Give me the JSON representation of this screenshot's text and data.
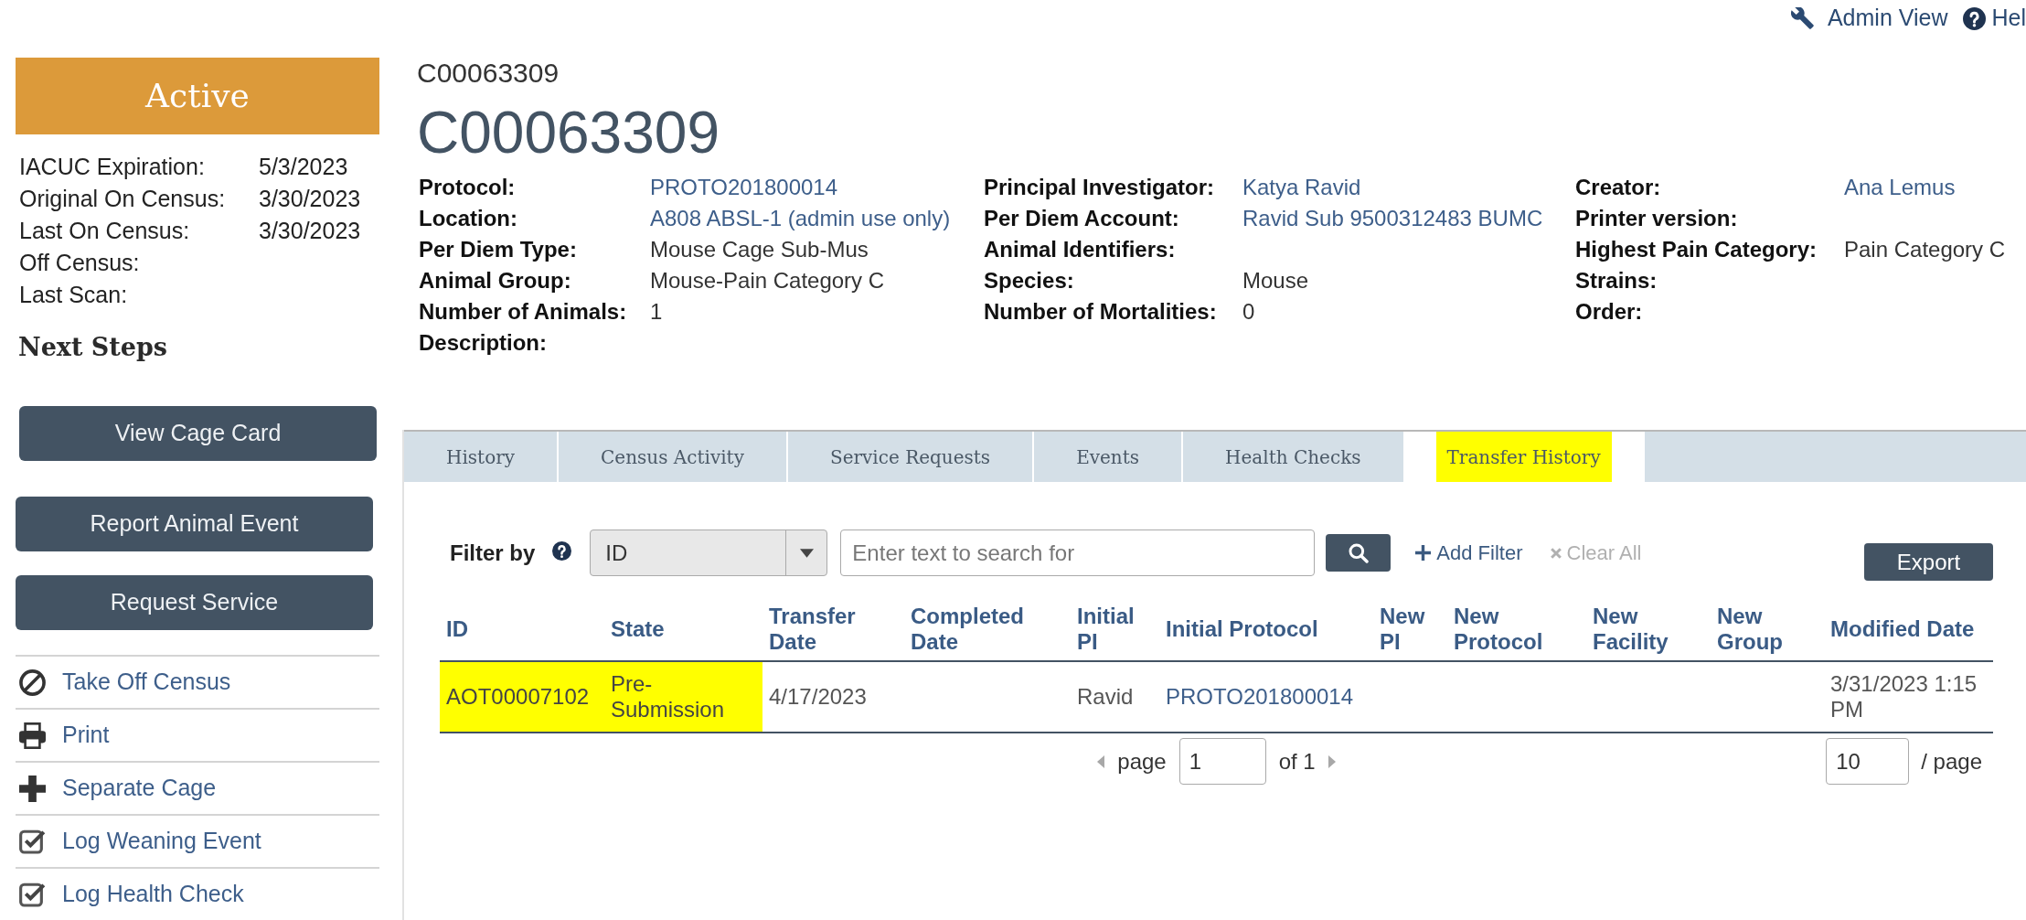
{
  "top_links": [
    {
      "kind": "admin",
      "label": "Admin View"
    },
    {
      "kind": "help",
      "label": "Hel"
    }
  ],
  "sidebar": {
    "status": "Active",
    "details": [
      {
        "label": "IACUC Expiration:",
        "value": "5/3/2023"
      },
      {
        "label": "Original On Census:",
        "value": "3/30/2023"
      },
      {
        "label": "Last On Census:",
        "value": "3/30/2023"
      },
      {
        "label": "Off Census:"
      },
      {
        "label": "Last Scan:"
      }
    ],
    "next_steps_title": "Next Steps",
    "buttons": [
      "View Cage Card",
      "Report Animal Event",
      "Request Service"
    ],
    "actions": [
      {
        "kind": "ban",
        "label": "Take Off Census"
      },
      {
        "kind": "print",
        "label": "Print"
      },
      {
        "kind": "plus",
        "label": "Separate Cage"
      },
      {
        "kind": "check",
        "label": "Log Weaning Event"
      },
      {
        "kind": "check",
        "label": "Log Health Check"
      }
    ]
  },
  "record": {
    "subtitle": "C00063309",
    "title": "C00063309",
    "field_columns": [
      [
        {
          "label": "Protocol:",
          "value": "PROTO201800014",
          "kind": "link"
        },
        {
          "label": "Location:",
          "value": "A808 ABSL-1 (admin use only)",
          "kind": "link"
        },
        {
          "label": "Per Diem Type:",
          "value": "Mouse Cage Sub-Mus",
          "kind": "text"
        },
        {
          "label": "Animal Group:",
          "value": "Mouse-Pain Category C",
          "kind": "text"
        },
        {
          "label": "Number of Animals:",
          "value": "1",
          "kind": "text"
        },
        {
          "label": "Description:"
        }
      ],
      [
        {
          "label": "Principal Investigator:",
          "value": "Katya Ravid",
          "kind": "link"
        },
        {
          "label": "Per Diem Account:",
          "value": "Ravid Sub 9500312483 BUMC",
          "kind": "link"
        },
        {
          "label": "Animal Identifiers:"
        },
        {
          "label": "Species:",
          "value": "Mouse",
          "kind": "text"
        },
        {
          "label": "Number of Mortalities:",
          "value": "0",
          "kind": "text"
        }
      ],
      [
        {
          "label": "Creator:",
          "value": "Ana Lemus",
          "kind": "link"
        },
        {
          "label": "Printer version:"
        },
        {
          "label": "Highest Pain Category:",
          "value": "Pain Category C",
          "kind": "text"
        },
        {
          "label": "Strains:"
        },
        {
          "label": "Order:"
        }
      ]
    ]
  },
  "tabs": [
    {
      "label": "History",
      "selected": false,
      "highlighted": false
    },
    {
      "label": "Census Activity",
      "selected": false,
      "highlighted": false
    },
    {
      "label": "Service Requests",
      "selected": false,
      "highlighted": false
    },
    {
      "label": "Events",
      "selected": false,
      "highlighted": false
    },
    {
      "label": "Health Checks",
      "selected": false,
      "highlighted": false
    },
    {
      "label": "Transfer History",
      "selected": true,
      "highlighted": true
    }
  ],
  "filter": {
    "label": "Filter by",
    "field": "ID",
    "placeholder": "Enter text to search for",
    "add_label": "Add Filter",
    "clear_label": "Clear All",
    "clear_disabled": true,
    "export_label": "Export"
  },
  "table": {
    "columns": [
      "ID",
      "State",
      "Transfer Date",
      "Completed Date",
      "Initial PI",
      "Initial Protocol",
      "New PI",
      "New Protocol",
      "New Facility",
      "New Group",
      "Modified Date"
    ],
    "rows": [
      {
        "cells": [
          {
            "text": "AOT00007102",
            "kind": "text",
            "highlighted": true
          },
          {
            "text": "Pre-Submission",
            "kind": "text",
            "highlighted": true
          },
          {
            "text": "4/17/2023",
            "kind": "text",
            "highlighted": false
          },
          null,
          {
            "text": "Ravid",
            "kind": "text",
            "highlighted": false
          },
          {
            "text": "PROTO201800014",
            "kind": "link",
            "highlighted": false
          },
          null,
          null,
          null,
          null,
          {
            "text": "3/31/2023 1:15 PM",
            "kind": "text",
            "highlighted": false
          }
        ]
      }
    ]
  },
  "pagination": {
    "page_label": "page",
    "page": "1",
    "of_label": "of 1",
    "page_size": "10",
    "per_page_label": "/ page"
  }
}
